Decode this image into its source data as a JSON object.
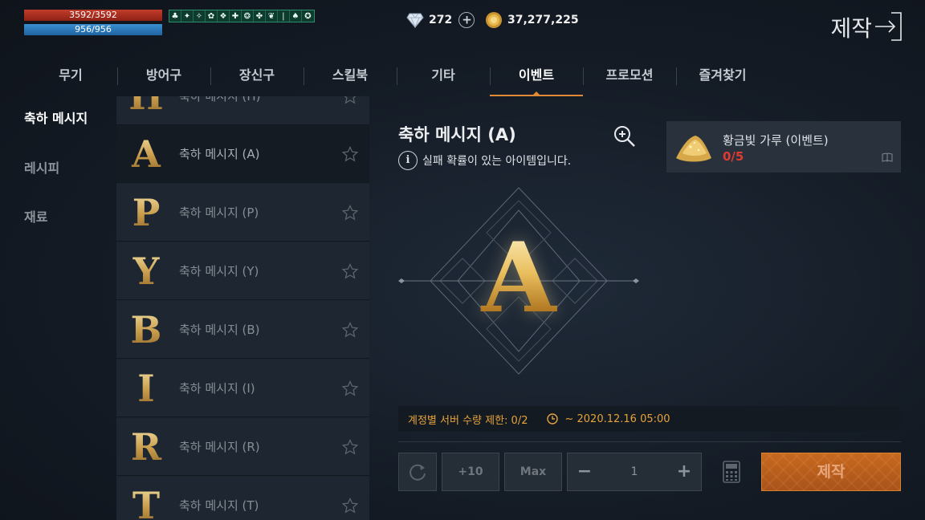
{
  "status": {
    "hp": "3592/3592",
    "mp": "956/956"
  },
  "buffs": [
    "♣",
    "✦",
    "✧",
    "✿",
    "❖",
    "✚",
    "❂",
    "✤",
    "❦",
    "❘",
    "♠",
    "✪"
  ],
  "currency": {
    "diamonds": "272",
    "gold": "37,277,225"
  },
  "header": {
    "title": "제작"
  },
  "tabs": [
    "무기",
    "방어구",
    "장신구",
    "스킬북",
    "기타",
    "이벤트",
    "프로모션",
    "즐겨찾기"
  ],
  "categories": [
    "축하 메시지",
    "레시피",
    "재료"
  ],
  "recipes": [
    {
      "letter": "H",
      "name": "축하 메시지 (H)"
    },
    {
      "letter": "A",
      "name": "축하 메시지 (A)"
    },
    {
      "letter": "P",
      "name": "축하 메시지 (P)"
    },
    {
      "letter": "Y",
      "name": "축하 메시지 (Y)"
    },
    {
      "letter": "B",
      "name": "축하 메시지 (B)"
    },
    {
      "letter": "I",
      "name": "축하 메시지 (I)"
    },
    {
      "letter": "R",
      "name": "축하 메시지 (R)"
    },
    {
      "letter": "T",
      "name": "축하 메시지 (T)"
    }
  ],
  "detail": {
    "title": "축하 메시지 (A)",
    "info": "실패 확률이 있는 아이템입니다.",
    "preview_letter": "A"
  },
  "material": {
    "name": "황금빛 가루 (이벤트)",
    "count": "0/5"
  },
  "limit": {
    "text": "계정별 서버 수량 제한: 0/2",
    "date": "~ 2020.12.16 05:00"
  },
  "controls": {
    "plus10": "+10",
    "max": "Max",
    "minus": "−",
    "quantity": "1",
    "plus": "+",
    "craft": "제작"
  },
  "colors": {
    "accent": "#e08a35",
    "hp": "#c23c2a",
    "mp": "#3a8fd0",
    "craft": "#c7691e",
    "warning": "#e03a32"
  }
}
